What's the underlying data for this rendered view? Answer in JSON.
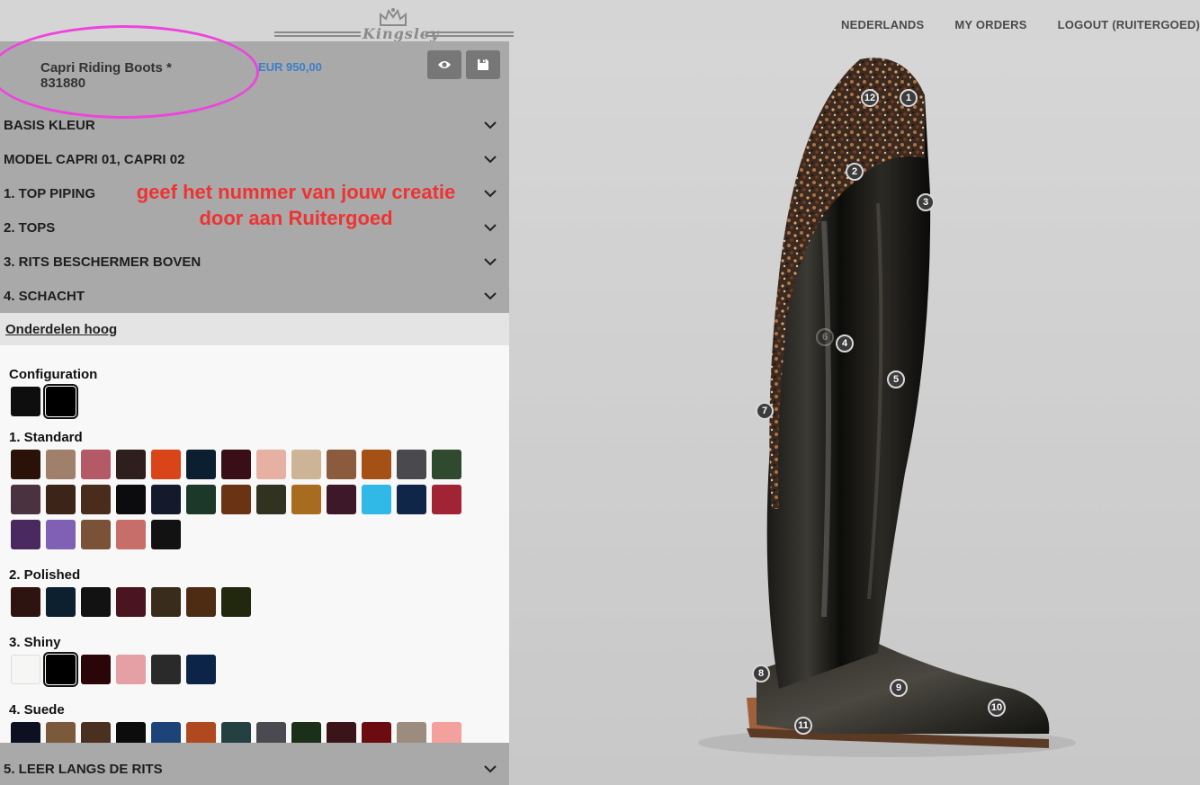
{
  "nav": {
    "language": "NEDERLANDS",
    "orders": "MY ORDERS",
    "logout": "LOGOUT (RUITERGOED)"
  },
  "logo": {
    "text": "Kingsley"
  },
  "product": {
    "name": "Capri Riding Boots *",
    "number": "831880",
    "price": "EUR 950,00"
  },
  "sections": [
    "BASIS KLEUR",
    "MODEL CAPRI 01, CAPRI 02",
    "1. TOP PIPING",
    "2. TOPS",
    "3. RITS BESCHERMER BOVEN",
    "4. SCHACHT"
  ],
  "annotation": "geef het nummer van jouw creatie door aan Ruitergoed",
  "subsection": "Onderdelen hoog",
  "groups": {
    "configuration": {
      "title": "Configuration",
      "colors": [
        "#0e0e0e",
        "#000000"
      ],
      "selected": 1
    },
    "standard": {
      "title": "1. Standard",
      "colors": [
        "#2a1208",
        "#a0806a",
        "#b35a66",
        "#2e1e1e",
        "#d94418",
        "#0c1f30",
        "#3a0e16",
        "#e6b0a2",
        "#cdb496",
        "#8c5a3c",
        "#a55014",
        "#4a4a4e",
        "#304a30",
        "#4a3240",
        "#3c2418",
        "#4a2c1c",
        "#0c0c0e",
        "#141a2c",
        "#1c3828",
        "#6a3414",
        "#323220",
        "#a86c20",
        "#3c1828",
        "#30b8e6",
        "#102648",
        "#a02434",
        "#4a2860",
        "#8060b4",
        "#7a5238",
        "#c86e68",
        "#121212"
      ]
    },
    "polished": {
      "title": "2. Polished",
      "colors": [
        "#2e1410",
        "#0c2030",
        "#121212",
        "#4a1420",
        "#3a2c1a",
        "#4e2c14",
        "#22280e"
      ]
    },
    "shiny": {
      "title": "3. Shiny",
      "colors": [
        "#f6f6f4",
        "#000000",
        "#2a0608",
        "#e4a0a4",
        "#2a2a2a",
        "#0c2448"
      ],
      "selected": 1
    },
    "suede": {
      "title": "4. Suede",
      "colors": [
        "#0c1020",
        "#7a5a3a",
        "#4a3020",
        "#0c0c0c",
        "#1c4478",
        "#b04820",
        "#244040",
        "#4a4a50",
        "#1a3018",
        "#3a1418",
        "#6c0c10",
        "#9c8c80",
        "#f4a09c"
      ]
    }
  },
  "bottom_section": "5. LEER LANGS DE RITS",
  "hotspots": [
    "1",
    "2",
    "3",
    "4",
    "5",
    "6",
    "7",
    "8",
    "9",
    "10",
    "11",
    "12"
  ],
  "colors": {
    "accent_price": "#3a7fc8",
    "annotation": "#ee3333",
    "highlight": "#ee44dd"
  }
}
